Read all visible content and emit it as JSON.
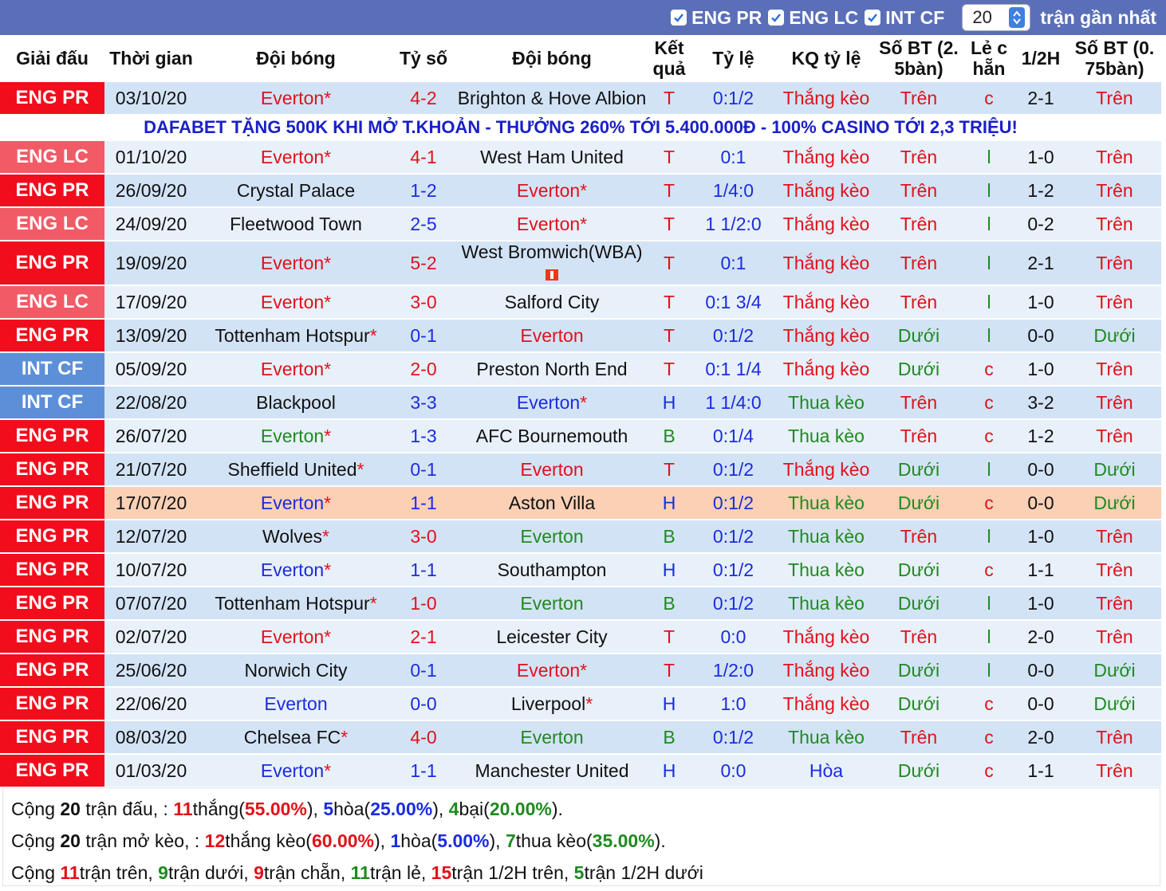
{
  "filters": {
    "items": [
      {
        "label": "ENG PR",
        "checked": true
      },
      {
        "label": "ENG LC",
        "checked": true
      },
      {
        "label": "INT CF",
        "checked": true
      }
    ],
    "count_value": "20",
    "recent_label": "trận gần nhất"
  },
  "headers": {
    "league": "Giải đấu",
    "time": "Thời gian",
    "team1": "Đội bóng",
    "score": "Tỷ số",
    "team2": "Đội bóng",
    "result": "Kết quả",
    "odds": "Tỷ lệ",
    "odds_result": "KQ tỷ lệ",
    "goals25": "Số BT (2. 5bàn)",
    "odd_even": "Lẻ c hẵn",
    "half": "1/2H",
    "goals075": "Số BT (0. 75bàn)"
  },
  "promo_text": "DAFABET TẶNG 500K KHI MỞ T.KHOẢN - THƯỞNG 260% TỚI 5.400.000Đ - 100% CASINO TỚI 2,3 TRIỆU!",
  "matches": [
    {
      "league": "ENG PR",
      "date": "03/10/20",
      "team1": "Everton",
      "team1_star": "*",
      "team1_color": "red",
      "score": "4-2",
      "score_color": "red",
      "team2": "Brighton & Hove Albion",
      "team2_star": "",
      "team2_color": "black",
      "result": "T",
      "result_color": "red",
      "odds": "0:1/2",
      "odds_result": "Thắng kèo",
      "or_color": "red",
      "goals25": "Trên",
      "g25_color": "red",
      "oe": "c",
      "oe_color": "red",
      "half": "2-1",
      "goals075": "Trên",
      "g075_color": "red",
      "style": "odd"
    },
    {
      "league": "ENG LC",
      "date": "01/10/20",
      "team1": "Everton",
      "team1_star": "*",
      "team1_color": "red",
      "score": "4-1",
      "score_color": "red",
      "team2": "West Ham United",
      "team2_star": "",
      "team2_color": "black",
      "result": "T",
      "result_color": "red",
      "odds": "0:1",
      "odds_result": "Thắng kèo",
      "or_color": "red",
      "goals25": "Trên",
      "g25_color": "red",
      "oe": "l",
      "oe_color": "green",
      "half": "1-0",
      "goals075": "Trên",
      "g075_color": "red",
      "style": "even"
    },
    {
      "league": "ENG PR",
      "date": "26/09/20",
      "team1": "Crystal Palace",
      "team1_star": "",
      "team1_color": "black",
      "score": "1-2",
      "score_color": "blue",
      "team2": "Everton",
      "team2_star": "*",
      "team2_color": "red",
      "result": "T",
      "result_color": "red",
      "odds": "1/4:0",
      "odds_result": "Thắng kèo",
      "or_color": "red",
      "goals25": "Trên",
      "g25_color": "red",
      "oe": "l",
      "oe_color": "green",
      "half": "1-2",
      "goals075": "Trên",
      "g075_color": "red",
      "style": "odd"
    },
    {
      "league": "ENG LC",
      "date": "24/09/20",
      "team1": "Fleetwood Town",
      "team1_star": "",
      "team1_color": "black",
      "score": "2-5",
      "score_color": "blue",
      "team2": "Everton",
      "team2_star": "*",
      "team2_color": "red",
      "result": "T",
      "result_color": "red",
      "odds": "1 1/2:0",
      "odds_result": "Thắng kèo",
      "or_color": "red",
      "goals25": "Trên",
      "g25_color": "red",
      "oe": "l",
      "oe_color": "green",
      "half": "0-2",
      "goals075": "Trên",
      "g075_color": "red",
      "style": "even"
    },
    {
      "league": "ENG PR",
      "date": "19/09/20",
      "team1": "Everton",
      "team1_star": "*",
      "team1_color": "red",
      "score": "5-2",
      "score_color": "red",
      "team2": "West Bromwich(WBA)",
      "team2_star": "",
      "team2_color": "black",
      "result": "T",
      "result_color": "red",
      "odds": "0:1",
      "odds_result": "Thắng kèo",
      "or_color": "red",
      "goals25": "Trên",
      "g25_color": "red",
      "oe": "l",
      "oe_color": "green",
      "half": "2-1",
      "goals075": "Trên",
      "g075_color": "red",
      "style": "odd"
    },
    {
      "league": "ENG LC",
      "date": "17/09/20",
      "team1": "Everton",
      "team1_star": "*",
      "team1_color": "red",
      "score": "3-0",
      "score_color": "red",
      "team2": "Salford City",
      "team2_star": "",
      "team2_color": "black",
      "result": "T",
      "result_color": "red",
      "odds": "0:1 3/4",
      "odds_result": "Thắng kèo",
      "or_color": "red",
      "goals25": "Trên",
      "g25_color": "red",
      "oe": "l",
      "oe_color": "green",
      "half": "1-0",
      "goals075": "Trên",
      "g075_color": "red",
      "style": "even"
    },
    {
      "league": "ENG PR",
      "date": "13/09/20",
      "team1": "Tottenham Hotspur",
      "team1_star": "*",
      "team1_color": "black",
      "score": "0-1",
      "score_color": "blue",
      "team2": "Everton",
      "team2_star": "",
      "team2_color": "red",
      "result": "T",
      "result_color": "red",
      "odds": "0:1/2",
      "odds_result": "Thắng kèo",
      "or_color": "red",
      "goals25": "Dưới",
      "g25_color": "green",
      "oe": "l",
      "oe_color": "green",
      "half": "0-0",
      "goals075": "Dưới",
      "g075_color": "green",
      "style": "odd"
    },
    {
      "league": "INT CF",
      "date": "05/09/20",
      "team1": "Everton",
      "team1_star": "*",
      "team1_color": "red",
      "score": "2-0",
      "score_color": "red",
      "team2": "Preston North End",
      "team2_star": "",
      "team2_color": "black",
      "result": "T",
      "result_color": "red",
      "odds": "0:1 1/4",
      "odds_result": "Thắng kèo",
      "or_color": "red",
      "goals25": "Dưới",
      "g25_color": "green",
      "oe": "c",
      "oe_color": "red",
      "half": "1-0",
      "goals075": "Trên",
      "g075_color": "red",
      "style": "even"
    },
    {
      "league": "INT CF",
      "date": "22/08/20",
      "team1": "Blackpool",
      "team1_star": "",
      "team1_color": "black",
      "score": "3-3",
      "score_color": "blue",
      "team2": "Everton",
      "team2_star": "*",
      "team2_color": "blue",
      "result": "H",
      "result_color": "blue",
      "odds": "1 1/4:0",
      "odds_result": "Thua kèo",
      "or_color": "green",
      "goals25": "Trên",
      "g25_color": "red",
      "oe": "c",
      "oe_color": "red",
      "half": "3-2",
      "goals075": "Trên",
      "g075_color": "red",
      "style": "odd"
    },
    {
      "league": "ENG PR",
      "date": "26/07/20",
      "team1": "Everton",
      "team1_star": "*",
      "team1_color": "green",
      "score": "1-3",
      "score_color": "blue",
      "team2": "AFC Bournemouth",
      "team2_star": "",
      "team2_color": "black",
      "result": "B",
      "result_color": "green",
      "odds": "0:1/4",
      "odds_result": "Thua kèo",
      "or_color": "green",
      "goals25": "Trên",
      "g25_color": "red",
      "oe": "c",
      "oe_color": "red",
      "half": "1-2",
      "goals075": "Trên",
      "g075_color": "red",
      "style": "even"
    },
    {
      "league": "ENG PR",
      "date": "21/07/20",
      "team1": "Sheffield United",
      "team1_star": "*",
      "team1_color": "black",
      "score": "0-1",
      "score_color": "blue",
      "team2": "Everton",
      "team2_star": "",
      "team2_color": "red",
      "result": "T",
      "result_color": "red",
      "odds": "0:1/2",
      "odds_result": "Thắng kèo",
      "or_color": "red",
      "goals25": "Dưới",
      "g25_color": "green",
      "oe": "l",
      "oe_color": "green",
      "half": "0-0",
      "goals075": "Dưới",
      "g075_color": "green",
      "style": "odd"
    },
    {
      "league": "ENG PR",
      "date": "17/07/20",
      "team1": "Everton",
      "team1_star": "*",
      "team1_color": "blue",
      "score": "1-1",
      "score_color": "blue",
      "team2": "Aston Villa",
      "team2_star": "",
      "team2_color": "black",
      "result": "H",
      "result_color": "blue",
      "odds": "0:1/2",
      "odds_result": "Thua kèo",
      "or_color": "green",
      "goals25": "Dưới",
      "g25_color": "green",
      "oe": "c",
      "oe_color": "red",
      "half": "0-0",
      "goals075": "Dưới",
      "g075_color": "green",
      "style": "hl"
    },
    {
      "league": "ENG PR",
      "date": "12/07/20",
      "team1": "Wolves",
      "team1_star": "*",
      "team1_color": "black",
      "score": "3-0",
      "score_color": "red",
      "team2": "Everton",
      "team2_star": "",
      "team2_color": "green",
      "result": "B",
      "result_color": "green",
      "odds": "0:1/2",
      "odds_result": "Thua kèo",
      "or_color": "green",
      "goals25": "Trên",
      "g25_color": "red",
      "oe": "l",
      "oe_color": "green",
      "half": "1-0",
      "goals075": "Trên",
      "g075_color": "red",
      "style": "odd"
    },
    {
      "league": "ENG PR",
      "date": "10/07/20",
      "team1": "Everton",
      "team1_star": "*",
      "team1_color": "blue",
      "score": "1-1",
      "score_color": "blue",
      "team2": "Southampton",
      "team2_star": "",
      "team2_color": "black",
      "result": "H",
      "result_color": "blue",
      "odds": "0:1/2",
      "odds_result": "Thua kèo",
      "or_color": "green",
      "goals25": "Dưới",
      "g25_color": "green",
      "oe": "c",
      "oe_color": "red",
      "half": "1-1",
      "goals075": "Trên",
      "g075_color": "red",
      "style": "even"
    },
    {
      "league": "ENG PR",
      "date": "07/07/20",
      "team1": "Tottenham Hotspur",
      "team1_star": "*",
      "team1_color": "black",
      "score": "1-0",
      "score_color": "red",
      "team2": "Everton",
      "team2_star": "",
      "team2_color": "green",
      "result": "B",
      "result_color": "green",
      "odds": "0:1/2",
      "odds_result": "Thua kèo",
      "or_color": "green",
      "goals25": "Dưới",
      "g25_color": "green",
      "oe": "l",
      "oe_color": "green",
      "half": "1-0",
      "goals075": "Trên",
      "g075_color": "red",
      "style": "odd"
    },
    {
      "league": "ENG PR",
      "date": "02/07/20",
      "team1": "Everton",
      "team1_star": "*",
      "team1_color": "red",
      "score": "2-1",
      "score_color": "red",
      "team2": "Leicester City",
      "team2_star": "",
      "team2_color": "black",
      "result": "T",
      "result_color": "red",
      "odds": "0:0",
      "odds_result": "Thắng kèo",
      "or_color": "red",
      "goals25": "Trên",
      "g25_color": "red",
      "oe": "l",
      "oe_color": "green",
      "half": "2-0",
      "goals075": "Trên",
      "g075_color": "red",
      "style": "even"
    },
    {
      "league": "ENG PR",
      "date": "25/06/20",
      "team1": "Norwich City",
      "team1_star": "",
      "team1_color": "black",
      "score": "0-1",
      "score_color": "blue",
      "team2": "Everton",
      "team2_star": "*",
      "team2_color": "red",
      "result": "T",
      "result_color": "red",
      "odds": "1/2:0",
      "odds_result": "Thắng kèo",
      "or_color": "red",
      "goals25": "Dưới",
      "g25_color": "green",
      "oe": "l",
      "oe_color": "green",
      "half": "0-0",
      "goals075": "Dưới",
      "g075_color": "green",
      "style": "odd"
    },
    {
      "league": "ENG PR",
      "date": "22/06/20",
      "team1": "Everton",
      "team1_star": "",
      "team1_color": "blue",
      "score": "0-0",
      "score_color": "blue",
      "team2": "Liverpool",
      "team2_star": "*",
      "team2_color": "black",
      "result": "H",
      "result_color": "blue",
      "odds": "1:0",
      "odds_result": "Thắng kèo",
      "or_color": "red",
      "goals25": "Dưới",
      "g25_color": "green",
      "oe": "c",
      "oe_color": "red",
      "half": "0-0",
      "goals075": "Dưới",
      "g075_color": "green",
      "style": "even"
    },
    {
      "league": "ENG PR",
      "date": "08/03/20",
      "team1": "Chelsea FC",
      "team1_star": "*",
      "team1_color": "black",
      "score": "4-0",
      "score_color": "red",
      "team2": "Everton",
      "team2_star": "",
      "team2_color": "green",
      "result": "B",
      "result_color": "green",
      "odds": "0:1/2",
      "odds_result": "Thua kèo",
      "or_color": "green",
      "goals25": "Trên",
      "g25_color": "red",
      "oe": "c",
      "oe_color": "red",
      "half": "2-0",
      "goals075": "Trên",
      "g075_color": "red",
      "style": "odd"
    },
    {
      "league": "ENG PR",
      "date": "01/03/20",
      "team1": "Everton",
      "team1_star": "*",
      "team1_color": "blue",
      "score": "1-1",
      "score_color": "blue",
      "team2": "Manchester United",
      "team2_star": "",
      "team2_color": "black",
      "result": "H",
      "result_color": "blue",
      "odds": "0:0",
      "odds_result": "Hòa",
      "or_color": "blue",
      "goals25": "Dưới",
      "g25_color": "green",
      "oe": "c",
      "oe_color": "red",
      "half": "1-1",
      "goals075": "Trên",
      "g075_color": "red",
      "style": "even"
    }
  ],
  "summary": {
    "line1": {
      "p1": "Cộng ",
      "total": "20",
      "p2": " trận đấu, : ",
      "wins": "11",
      "p3": "thắng(",
      "win_pct": "55.00%",
      "p4": "), ",
      "draws": "5",
      "p5": "hòa(",
      "draw_pct": "25.00%",
      "p6": "), ",
      "losses": "4",
      "p7": "bại(",
      "loss_pct": "20.00%",
      "p8": ")."
    },
    "line2": {
      "p1": "Cộng ",
      "total": "20",
      "p2": " trận mở kèo, : ",
      "wins": "12",
      "p3": "thắng kèo(",
      "win_pct": "60.00%",
      "p4": "), ",
      "draws": "1",
      "p5": "hòa(",
      "draw_pct": "5.00%",
      "p6": "), ",
      "losses": "7",
      "p7": "thua kèo(",
      "loss_pct": "35.00%",
      "p8": ")."
    },
    "line3": {
      "p1": "Cộng ",
      "over": "11",
      "p2": "trận trên, ",
      "under": "9",
      "p3": "trận dưới, ",
      "even": "9",
      "p4": "trận chẵn, ",
      "odd": "11",
      "p5": "trận lẻ, ",
      "h_over": "15",
      "p6": "trận 1/2H trên, ",
      "h_under": "5",
      "p7": "trận 1/2H dưới"
    }
  },
  "colors": {
    "red": "#e0121a",
    "blue": "#1a2ce0",
    "green": "#1f8a1f",
    "black": "#111111",
    "promo": "#1a20c8",
    "topbar": "#5b6fb8"
  }
}
